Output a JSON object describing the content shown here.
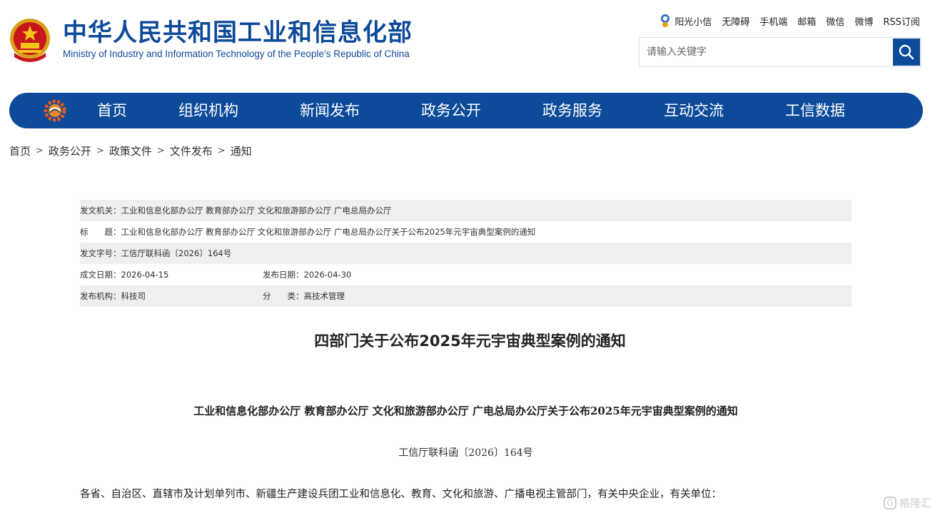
{
  "header": {
    "site_name_cn": "中华人民共和国工业和信息化部",
    "site_name_en": "Ministry of Industry and Information Technology of the People’s Republic of China",
    "top_links": [
      "阳光小信",
      "无障碍",
      "手机端",
      "邮箱",
      "微信",
      "微博",
      "RSS订阅"
    ],
    "search": {
      "placeholder": "请输入关键字",
      "value": ""
    }
  },
  "nav": {
    "items": [
      "首页",
      "组织机构",
      "新闻发布",
      "政务公开",
      "政务服务",
      "互动交流",
      "工信数据"
    ]
  },
  "breadcrumb": {
    "items": [
      "首页",
      "政务公开",
      "政策文件",
      "文件发布",
      "通知"
    ],
    "separator": ">"
  },
  "meta": {
    "issuer_label": "发文机关：",
    "issuer": "工业和信息化部办公厅 教育部办公厅 文化和旅游部办公厅 广电总局办公厅",
    "title_label": "标　　题：",
    "title": "工业和信息化部办公厅 教育部办公厅 文化和旅游部办公厅 广电总局办公厅关于公布2025年元宇宙典型案例的通知",
    "docno_label": "发文字号：",
    "docno": "工信厅联科函〔2026〕164号",
    "date_label": "成文日期：",
    "date": "2026-04-15",
    "pub_date_label": "发布日期：",
    "pub_date": "2026-04-30",
    "org_label": "发布机构：",
    "org": "科技司",
    "category_label": "分　　类：",
    "category": "高技术管理"
  },
  "document": {
    "title": "四部门关于公布2025年元宇宙典型案例的通知",
    "subtitle": "工业和信息化部办公厅  教育部办公厅  文化和旅游部办公厅  广电总局办公厅关于公布2025年元宇宙典型案例的通知",
    "doc_no": "工信厅联科函〔2026〕164号",
    "body_first_line": "各省、自治区、直辖市及计划单列市、新疆生产建设兵团工业和信息化、教育、文化和旅游、广播电视主管部门，有关中央企业，有关单位："
  },
  "watermark": {
    "text": "格隆汇"
  },
  "colors": {
    "brand_blue": "#0d4a9a",
    "meta_row_gray": "#efefef"
  }
}
